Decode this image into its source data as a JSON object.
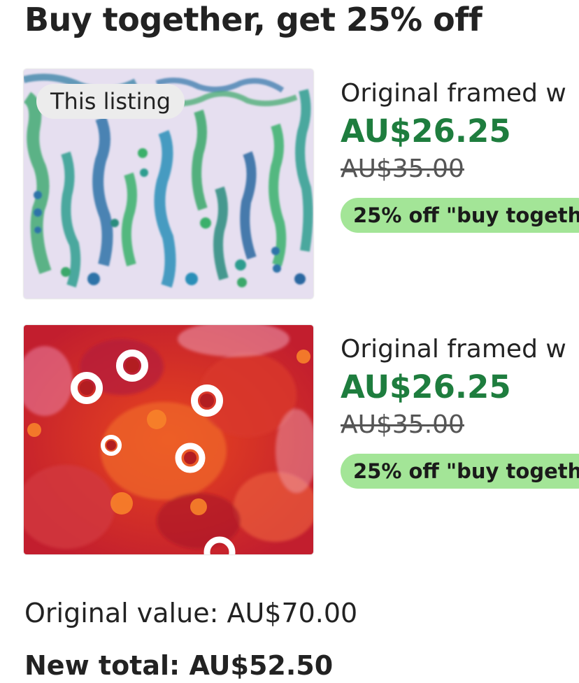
{
  "header": {
    "title": "Buy together, get 25% off"
  },
  "listings": [
    {
      "badge": "This listing",
      "name": "Original framed w",
      "price": "AU$26.25",
      "original_price": "AU$35.00",
      "promo": "25% off \"buy togeth",
      "image_palette": "blue-green watercolor"
    },
    {
      "badge": "",
      "name": "Original framed w",
      "price": "AU$26.25",
      "original_price": "AU$35.00",
      "promo": "25% off \"buy togeth",
      "image_palette": "red-orange alcohol ink"
    }
  ],
  "summary": {
    "original_value": "Original value: AU$70.00",
    "new_total": "New total: AU$52.50"
  },
  "colors": {
    "sale_price": "#1e7d3e",
    "promo_bg": "#a3e597",
    "badge_bg": "#ececec"
  }
}
